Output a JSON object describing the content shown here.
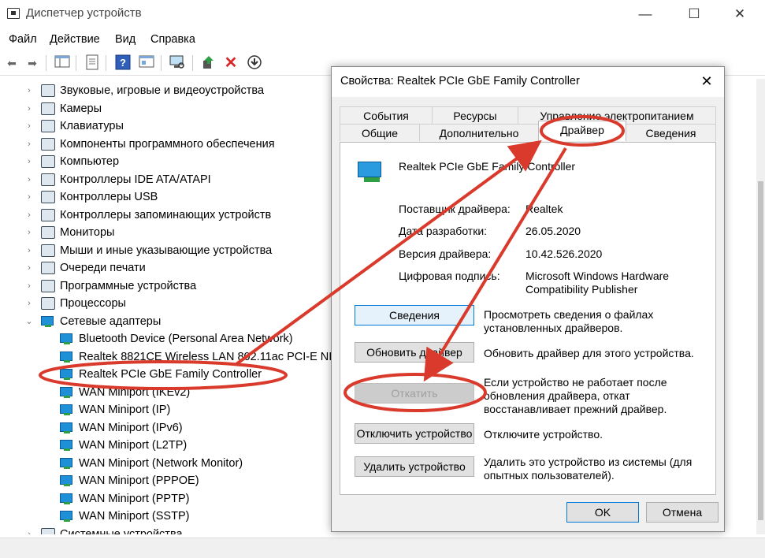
{
  "window": {
    "title": "Диспетчер устройств",
    "minimize": "—",
    "maximize": "☐",
    "close": "✕"
  },
  "menu": [
    "Файл",
    "Действие",
    "Вид",
    "Справка"
  ],
  "tree": {
    "items": [
      {
        "label": "Звуковые, игровые и видеоустройства",
        "icon": "speaker-icon"
      },
      {
        "label": "Камеры",
        "icon": "camera-icon"
      },
      {
        "label": "Клавиатуры",
        "icon": "keyboard-icon"
      },
      {
        "label": "Компоненты программного обеспечения",
        "icon": "software-component-icon"
      },
      {
        "label": "Компьютер",
        "icon": "computer-icon"
      },
      {
        "label": "Контроллеры IDE ATA/ATAPI",
        "icon": "ide-controller-icon"
      },
      {
        "label": "Контроллеры USB",
        "icon": "usb-icon"
      },
      {
        "label": "Контроллеры запоминающих устройств",
        "icon": "storage-controller-icon"
      },
      {
        "label": "Мониторы",
        "icon": "monitor-icon"
      },
      {
        "label": "Мыши и иные указывающие устройства",
        "icon": "mouse-icon"
      },
      {
        "label": "Очереди печати",
        "icon": "printer-icon"
      },
      {
        "label": "Программные устройства",
        "icon": "software-device-icon"
      },
      {
        "label": "Процессоры",
        "icon": "processor-icon"
      },
      {
        "label": "Сетевые адаптеры",
        "icon": "network-adapter-icon",
        "expanded": true
      }
    ],
    "adapters": [
      "Bluetooth Device (Personal Area Network)",
      "Realtek 8821CE Wireless LAN 802.11ac PCI-E NIC",
      "Realtek PCIe GbE Family Controller",
      "WAN Miniport (IKEv2)",
      "WAN Miniport (IP)",
      "WAN Miniport (IPv6)",
      "WAN Miniport (L2TP)",
      "WAN Miniport (Network Monitor)",
      "WAN Miniport (PPPOE)",
      "WAN Miniport (PPTP)",
      "WAN Miniport (SSTP)"
    ],
    "last_item": "Системные устройства"
  },
  "dialog": {
    "title": "Свойства: Realtek PCIe GbE Family Controller",
    "close": "✕",
    "tabs_row1": [
      "События",
      "Ресурсы",
      "Управление электропитанием"
    ],
    "tabs_row2": [
      "Общие",
      "Дополнительно",
      "Драйвер",
      "Сведения"
    ],
    "active_tab": "Драйвер",
    "device_name": "Realtek PCIe GbE Family Controller",
    "props": [
      {
        "label": "Поставщик драйвера:",
        "value": "Realtek"
      },
      {
        "label": "Дата разработки:",
        "value": "26.05.2020"
      },
      {
        "label": "Версия драйвера:",
        "value": "10.42.526.2020"
      },
      {
        "label": "Цифровая подпись:",
        "value": "Microsoft Windows Hardware Compatibility Publisher"
      }
    ],
    "actions": [
      {
        "label": "Сведения",
        "desc": "Просмотреть сведения о файлах установленных драйверов.",
        "state": "focus"
      },
      {
        "label": "Обновить драйвер",
        "desc": "Обновить драйвер для этого устройства.",
        "state": "normal"
      },
      {
        "label": "Откатить",
        "desc": "Если устройство не работает после обновления драйвера, откат восстанавливает прежний драйвер.",
        "state": "disabled"
      },
      {
        "label": "Отключить устройство",
        "desc": "Отключите устройство.",
        "state": "normal"
      },
      {
        "label": "Удалить устройство",
        "desc": "Удалить это устройство из системы (для опытных пользователей).",
        "state": "normal"
      }
    ],
    "ok": "OK",
    "cancel": "Отмена"
  },
  "annotation_color": "#d93a2b"
}
